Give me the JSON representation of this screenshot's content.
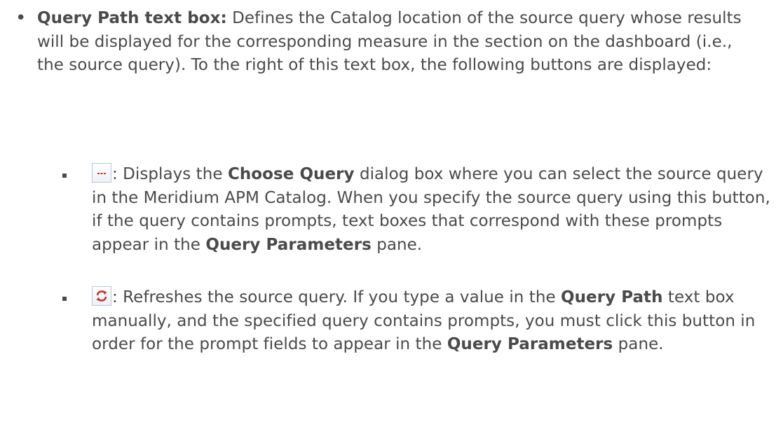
{
  "item": {
    "term": "Query Path text box:",
    "description": " Defines the Catalog location of the source query whose results will be displayed for the corresponding measure in the section on the dashboard (i.e., the source query). To the right of this text box, the following buttons are displayed:"
  },
  "buttons": [
    {
      "icon": "ellipsis-browse-icon",
      "segments": [
        ": Displays the ",
        "Choose Query",
        " dialog box where you can select the source query in the Meridium APM Catalog. When you specify the source query using this button, if the query contains prompts, text boxes that correspond with these prompts appear in the ",
        "Query Parameters",
        " pane."
      ]
    },
    {
      "icon": "refresh-icon",
      "segments": [
        ": Refreshes the source query. If you type a value in the ",
        "Query Path",
        " text box manually, and the specified query contains prompts, you must click this button in order for the prompt fields to appear in the ",
        "Query Parameters",
        " pane."
      ]
    }
  ]
}
